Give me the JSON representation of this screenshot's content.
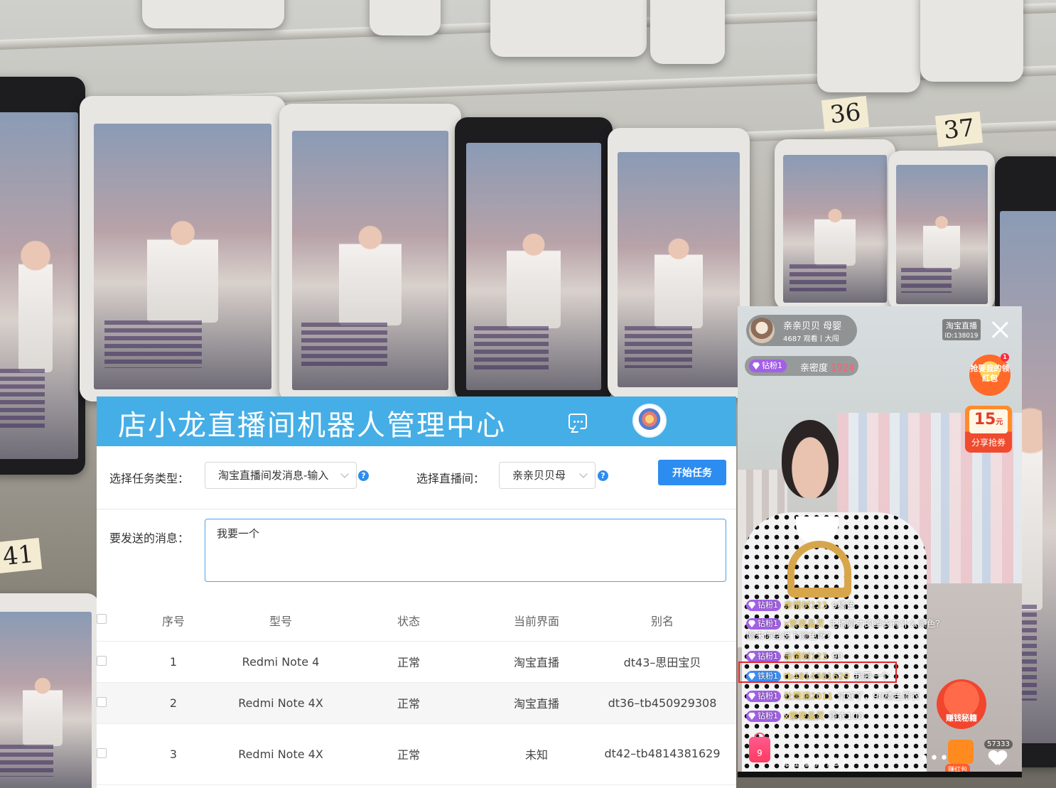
{
  "panel": {
    "title": "店小龙直播间机器人管理中心",
    "task_type_label": "选择任务类型：",
    "task_type_value": "淘宝直播间发消息-输入",
    "room_label": "选择直播间：",
    "room_value": "亲亲贝贝母",
    "start_button": "开始任务",
    "message_label": "要发送的消息：",
    "message_value": "我要一个",
    "help_glyph": "?",
    "accent_color": "#45aee6",
    "button_color": "#2d8cf0"
  },
  "table": {
    "headers": [
      "序号",
      "型号",
      "状态",
      "当前界面",
      "别名"
    ],
    "rows": [
      {
        "index": "1",
        "model": "Redmi Note 4",
        "status": "正常",
        "screen": "淘宝直播",
        "alias": "dt43–思田宝贝"
      },
      {
        "index": "2",
        "model": "Redmi Note 4X",
        "status": "正常",
        "screen": "淘宝直播",
        "alias": "dt36–tb450929308"
      },
      {
        "index": "3",
        "model": "Redmi Note 4X",
        "status": "正常",
        "screen": "未知",
        "alias": "dt42–tb4814381629"
      }
    ]
  },
  "live": {
    "anchor_name": "亲亲贝贝 母婴",
    "anchor_views": "4687 观看丨大闯",
    "platform_badge": "淘宝直播",
    "room_id": "ID:138019",
    "fan_level": "钻粉1",
    "intimacy_label": "亲密度",
    "intimacy_value": "1924",
    "redpack_text": "抢要我的领红包",
    "redpack_badge": "1",
    "coupon_amount": "15",
    "coupon_unit": "元",
    "coupon_label": "分享抢券",
    "comments": [
      {
        "level": "钻粉1",
        "user": "亲情树123",
        "text": "9橘色"
      },
      {
        "level": "钻粉1",
        "user": "x紫夜晶灵",
        "text": "主播刚才的罩衣有什么颜色？刚来你给说下颜色呀？"
      },
      {
        "level": "钻粉1",
        "user": "亲情树123",
        "text": "90"
      },
      {
        "level": "铁粉1",
        "user": "tb4814381629",
        "text": "我要一个"
      },
      {
        "level": "钻粉1",
        "user": "杜雨涵2011",
        "text": "付好了，90橘色罩衣"
      },
      {
        "level": "钻粉1",
        "user": "x紫夜晶灵",
        "text": "罩衣100"
      }
    ],
    "secret_pack": "赚钱秘籍",
    "cart_count": "9",
    "chat_prompt": "跟主播聊什么？",
    "more": "•••",
    "earn_label": "赚红包",
    "likes": "57333"
  },
  "background": {
    "shelf_labels": [
      "36",
      "37",
      "41"
    ]
  }
}
